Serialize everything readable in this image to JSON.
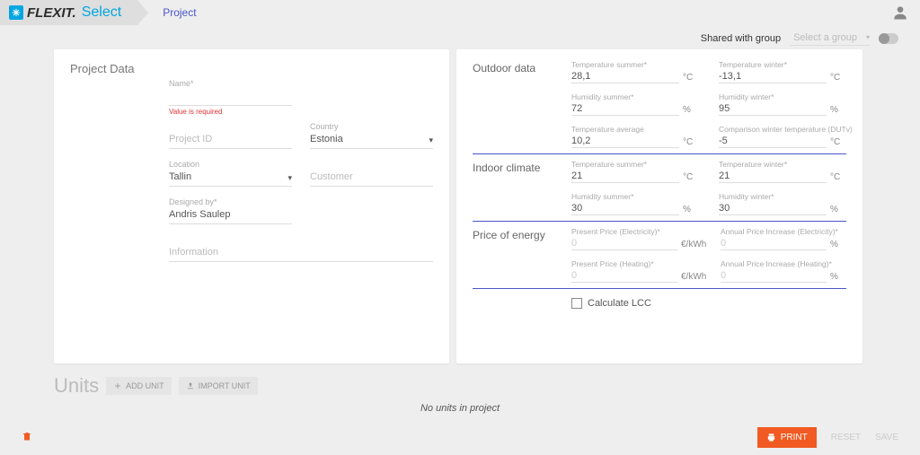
{
  "header": {
    "logo_main": "FLEXIT.",
    "logo_sub": "Select",
    "breadcrumb": "Project"
  },
  "share": {
    "label": "Shared with group",
    "placeholder": "Select a group"
  },
  "project_data": {
    "title": "Project Data",
    "name_label": "Name*",
    "name_value": "",
    "name_error": "Value is required",
    "project_id_label": "Project ID",
    "project_id_value": "",
    "country_label": "Country",
    "country_value": "Estonia",
    "location_label": "Location",
    "location_value": "Tallin",
    "customer_label": "Customer",
    "customer_value": "",
    "designed_by_label": "Designed by*",
    "designed_by_value": "Andris Saulep",
    "information_label": "Information",
    "information_value": ""
  },
  "outdoor": {
    "title": "Outdoor data",
    "temp_summer_label": "Temperature summer*",
    "temp_summer_value": "28,1",
    "temp_winter_label": "Temperature winter*",
    "temp_winter_value": "-13,1",
    "hum_summer_label": "Humidity summer*",
    "hum_summer_value": "72",
    "hum_winter_label": "Humidity winter*",
    "hum_winter_value": "95",
    "temp_avg_label": "Temperature average",
    "temp_avg_value": "10,2",
    "dutv_label": "Comparison winter temperature (DUTv)",
    "dutv_value": "-5",
    "unit_c": "°C",
    "unit_pct": "%"
  },
  "indoor": {
    "title": "Indoor climate",
    "temp_summer_label": "Temperature summer*",
    "temp_summer_value": "21",
    "temp_winter_label": "Temperature winter*",
    "temp_winter_value": "21",
    "hum_summer_label": "Humidity summer*",
    "hum_summer_value": "30",
    "hum_winter_label": "Humidity winter*",
    "hum_winter_value": "30"
  },
  "energy": {
    "title": "Price of energy",
    "elec_price_label": "Present Price (Electricity)*",
    "elec_price_value": "0",
    "elec_inc_label": "Annual Price Increase (Electricity)*",
    "elec_inc_value": "0",
    "heat_price_label": "Present Price (Heating)*",
    "heat_price_value": "0",
    "heat_inc_label": "Annual Price Increase (Heating)*",
    "heat_inc_value": "0",
    "unit_eurkwh": "€/kWh",
    "lcc_label": "Calculate LCC"
  },
  "units": {
    "title": "Units",
    "add_label": "ADD UNIT",
    "import_label": "IMPORT UNIT",
    "empty": "No units in project"
  },
  "footer": {
    "print": "PRINT",
    "reset": "RESET",
    "save": "SAVE"
  }
}
